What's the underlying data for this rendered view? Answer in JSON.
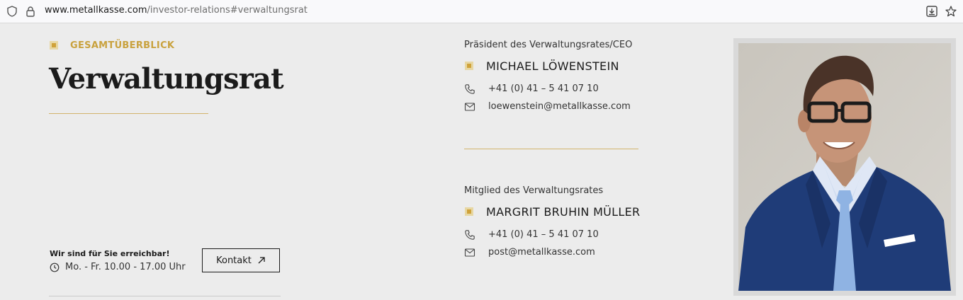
{
  "browser": {
    "url_domain": "www.metallkasse.com",
    "url_path": "/investor-relations#verwaltungsrat"
  },
  "section": {
    "eyebrow": "GESAMTÜBERBLICK",
    "title": "Verwaltungsrat"
  },
  "reach": {
    "title": "Wir sind für Sie erreichbar!",
    "hours": "Mo. - Fr. 10.00 - 17.00 Uhr",
    "button_label": "Kontakt"
  },
  "members": [
    {
      "role": "Präsident des Verwaltungsrates/CEO",
      "name": "MICHAEL LÖWENSTEIN",
      "phone": "+41 (0) 41 – 5 41 07 10",
      "email": "loewenstein@metallkasse.com"
    },
    {
      "role": "Mitglied des Verwaltungsrates",
      "name": "MARGRIT BRUHIN MÜLLER",
      "phone": "+41 (0) 41 – 5 41 07 10",
      "email": "post@metallkasse.com"
    }
  ],
  "colors": {
    "accent_gold": "#c9a23e",
    "background": "#ececec",
    "text_dark": "#1b1b1b"
  }
}
